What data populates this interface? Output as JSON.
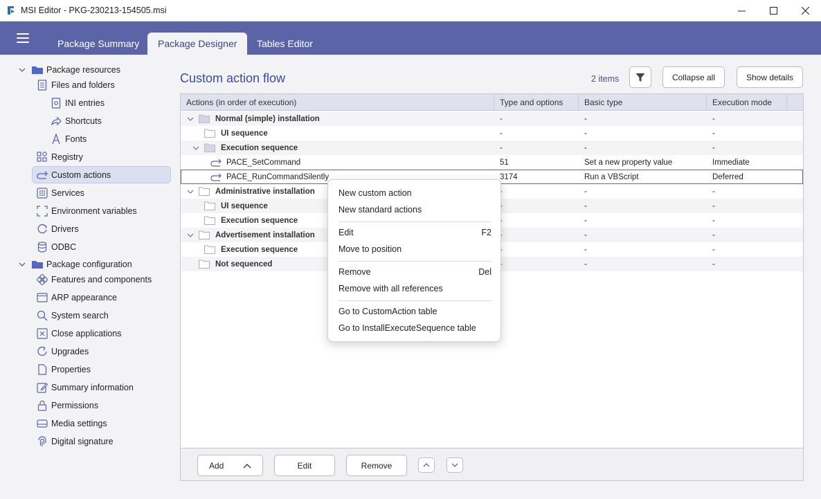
{
  "window": {
    "title": "MSI Editor - PKG-230213-154505.msi"
  },
  "tabs": [
    {
      "label": "Package Summary"
    },
    {
      "label": "Package Designer"
    },
    {
      "label": "Tables Editor"
    }
  ],
  "sidebar": {
    "items": [
      {
        "label": "Package resources"
      },
      {
        "label": "Files and folders"
      },
      {
        "label": "INI entries"
      },
      {
        "label": "Shortcuts"
      },
      {
        "label": "Fonts"
      },
      {
        "label": "Registry"
      },
      {
        "label": "Custom actions"
      },
      {
        "label": "Services"
      },
      {
        "label": "Environment variables"
      },
      {
        "label": "Drivers"
      },
      {
        "label": "ODBC"
      },
      {
        "label": "Package configuration"
      },
      {
        "label": "Features and components"
      },
      {
        "label": "ARP appearance"
      },
      {
        "label": "System search"
      },
      {
        "label": "Close applications"
      },
      {
        "label": "Upgrades"
      },
      {
        "label": "Properties"
      },
      {
        "label": "Summary information"
      },
      {
        "label": "Permissions"
      },
      {
        "label": "Media settings"
      },
      {
        "label": "Digital signature"
      }
    ]
  },
  "main": {
    "title": "Custom action flow",
    "count": "2 items",
    "collapse_all": "Collapse all",
    "show_details": "Show details"
  },
  "table": {
    "columns": [
      "Actions (in order of execution)",
      "Type and options",
      "Basic type",
      "Execution mode"
    ],
    "rows": [
      {
        "name": "Normal (simple) installation",
        "type": "-",
        "basic": "-",
        "mode": "-"
      },
      {
        "name": "UI sequence",
        "type": "-",
        "basic": "-",
        "mode": "-"
      },
      {
        "name": "Execution sequence",
        "type": "-",
        "basic": "-",
        "mode": "-"
      },
      {
        "name": "PACE_SetCommand",
        "type": "51",
        "basic": "Set a new property value",
        "mode": "Immediate"
      },
      {
        "name": "PACE_RunCommandSilently",
        "type": "3174",
        "basic": "Run a VBScript",
        "mode": "Deferred"
      },
      {
        "name": "Administrative installation",
        "type": "-",
        "basic": "-",
        "mode": "-"
      },
      {
        "name": "UI sequence",
        "type": "-",
        "basic": "-",
        "mode": "-"
      },
      {
        "name": "Execution sequence",
        "type": "-",
        "basic": "-",
        "mode": "-"
      },
      {
        "name": "Advertisement installation",
        "type": "-",
        "basic": "-",
        "mode": "-"
      },
      {
        "name": "Execution sequence",
        "type": "-",
        "basic": "-",
        "mode": "-"
      },
      {
        "name": "Not sequenced",
        "type": "-",
        "basic": "-",
        "mode": "-"
      }
    ]
  },
  "footer": {
    "add": "Add",
    "edit": "Edit",
    "remove": "Remove"
  },
  "context_menu": {
    "new_custom": "New custom action",
    "new_standard": "New standard actions",
    "edit": "Edit",
    "edit_key": "F2",
    "move": "Move to position",
    "remove": "Remove",
    "remove_key": "Del",
    "remove_all": "Remove with all references",
    "goto_ca": "Go to CustomAction table",
    "goto_ies": "Go to InstallExecuteSequence table"
  },
  "colors": {
    "accent": "#5b64a6",
    "title_blue": "#3c4aa0",
    "selection": "#dcdff0"
  }
}
